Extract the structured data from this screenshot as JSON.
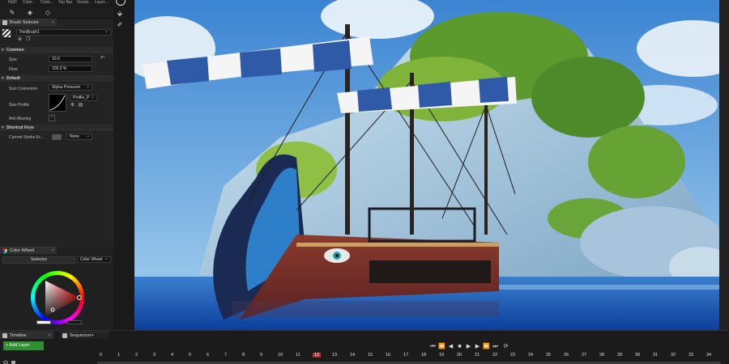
{
  "top_toolbar": {
    "items": [
      "HUD",
      "Color...",
      "Color...",
      "Top Bar",
      "Vector...",
      "Layer..."
    ]
  },
  "brush_selector": {
    "tab_label": "Brush Selector",
    "brush_name": "PenBrush1",
    "sections": {
      "common": "Common",
      "default": "Default",
      "shortcut_keys": "Shortcut Keys"
    },
    "size_label": "Size",
    "size_value": "10.0",
    "flow_label": "Flow",
    "flow_value": "100.0 %",
    "size_connexion_label": "Size Connexion",
    "size_connexion_value": "Stylus Pressure",
    "size_profile_label": "Size Profile",
    "size_profile_value": "Profile_P",
    "anti_aliasing_label": "Anti Aliasing",
    "anti_aliasing_checked": true,
    "current_stroke_label": "Current Stroke Er...",
    "current_stroke_value": "None"
  },
  "color_wheel": {
    "tab_label": "Color Wheel",
    "selector_label": "Selector",
    "mode_value": "Color Wheel"
  },
  "timeline": {
    "tab_label": "Timeline",
    "sequencer_label": "Sequencer+",
    "add_layer_label": "+ Add Layer",
    "current_frame": "12",
    "frames": [
      "0",
      "1",
      "2",
      "3",
      "4",
      "5",
      "6",
      "7",
      "8",
      "9",
      "10",
      "11",
      "12",
      "13",
      "14",
      "15",
      "16",
      "17",
      "18",
      "19",
      "20",
      "21",
      "22",
      "23",
      "24",
      "25",
      "26",
      "27",
      "28",
      "29",
      "30",
      "31",
      "32",
      "33",
      "34"
    ]
  },
  "colors": {
    "accent_green": "#2f8f32",
    "playhead_red": "#b03030",
    "panel_bg": "#232323"
  }
}
